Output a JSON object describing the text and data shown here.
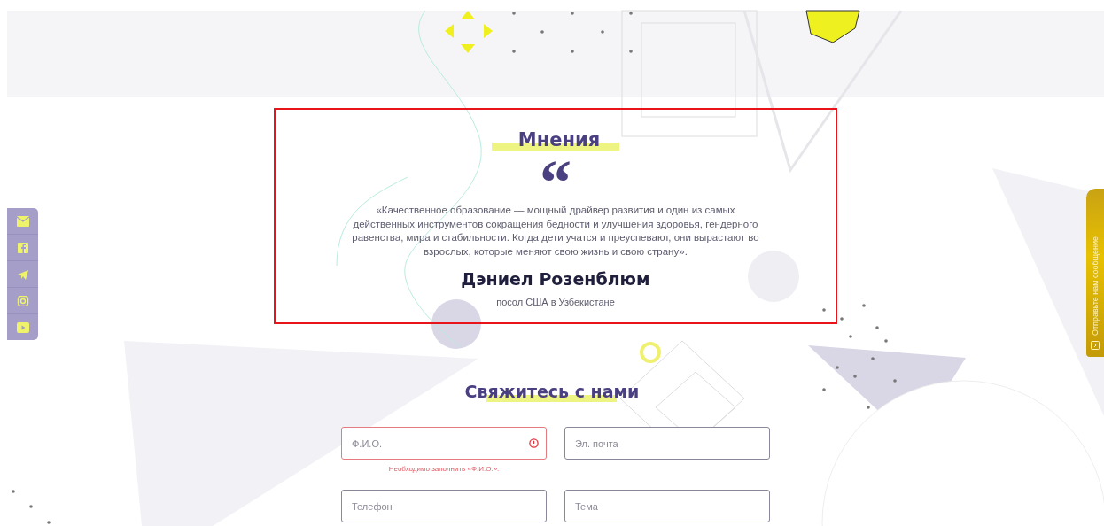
{
  "social_bar": {
    "items": [
      {
        "kind": "mail"
      },
      {
        "kind": "facebook"
      },
      {
        "kind": "telegram"
      },
      {
        "kind": "instagram"
      },
      {
        "kind": "youtube"
      }
    ]
  },
  "side_tab": {
    "label": "Отправьте нам сообщение"
  },
  "opinions": {
    "title": "Мнения",
    "quote_mark": "“",
    "quote": "«Качественное образование — мощный драйвер развития и один из самых действенных инструментов сокращения бедности и улучшения здоровья, гендерного равенства, мира и стабильности. Когда дети учатся и преуспевают, они вырастают во взрослых, которые меняют свою жизнь и свою страну».",
    "author": "Дэниел Розенблюм",
    "role": "посол США в Узбекистане"
  },
  "contact": {
    "title": "Свяжитесь с нами",
    "fields": [
      {
        "placeholder": "Ф.И.О.",
        "invalid": true,
        "error": "Необходимо заполнить «Ф.И.О.»."
      },
      {
        "placeholder": "Эл. почта",
        "invalid": false
      },
      {
        "placeholder": "Телефон",
        "invalid": false
      },
      {
        "placeholder": "Тема",
        "invalid": false
      }
    ]
  }
}
